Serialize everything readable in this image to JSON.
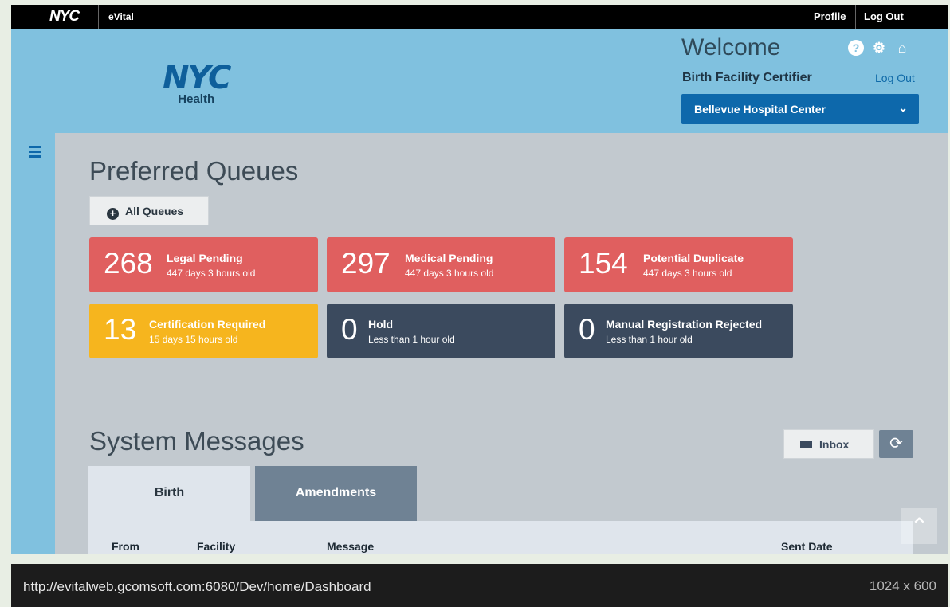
{
  "topbar": {
    "logo": "NYC",
    "app_name": "eVital",
    "profile": "Profile",
    "logout": "Log Out"
  },
  "header": {
    "brand_big": "NYC",
    "brand_sub": "Health",
    "welcome": "Welcome",
    "role": "Birth Facility Certifier",
    "logout": "Log Out",
    "facility": "Bellevue Hospital Center",
    "icons": [
      "question-icon",
      "gear-icon",
      "home-icon"
    ]
  },
  "queues": {
    "title": "Preferred Queues",
    "all_queues": "All Queues",
    "tiles": [
      {
        "count": "268",
        "label": "Legal Pending",
        "age": "447 days 3 hours old",
        "color": "#e05f5f"
      },
      {
        "count": "297",
        "label": "Medical Pending",
        "age": "447 days 3 hours old",
        "color": "#e05f5f"
      },
      {
        "count": "154",
        "label": "Potential Duplicate",
        "age": "447 days 3 hours old",
        "color": "#e05f5f"
      },
      {
        "count": "13",
        "label": "Certification Required",
        "age": "15 days 15 hours old",
        "color": "#f6b51e"
      },
      {
        "count": "0",
        "label": "Hold",
        "age": "Less than 1 hour old",
        "color": "#3b4a5e"
      },
      {
        "count": "0",
        "label": "Manual Registration Rejected",
        "age": "Less than 1 hour old",
        "color": "#3b4a5e"
      }
    ]
  },
  "messages": {
    "title": "System Messages",
    "inbox": "Inbox",
    "tabs": [
      "Birth",
      "Amendments"
    ],
    "columns": [
      "From",
      "Facility",
      "Message",
      "Sent Date"
    ]
  },
  "footer": {
    "url": "http://evitalweb.gcomsoft.com:6080/Dev/home/Dashboard",
    "dims": "1024 x 600"
  }
}
